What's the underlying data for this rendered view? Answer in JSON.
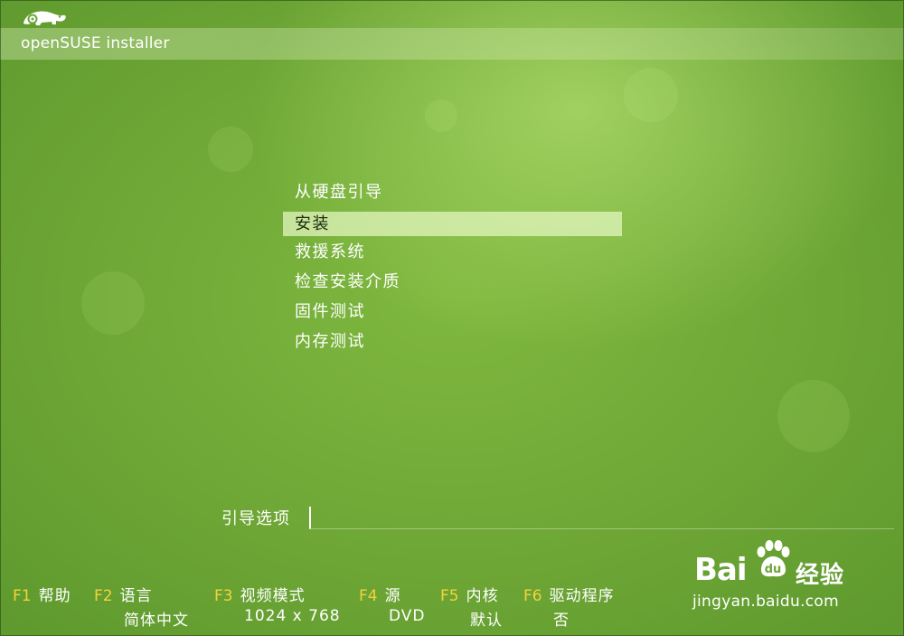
{
  "header": {
    "title": "openSUSE installer",
    "logo_icon": "chameleon-logo-icon"
  },
  "menu": {
    "items": [
      {
        "label": "从硬盘引导",
        "selected": false
      },
      {
        "label": "安装",
        "selected": true
      },
      {
        "label": "救援系统",
        "selected": false
      },
      {
        "label": "检查安装介质",
        "selected": false
      },
      {
        "label": "固件测试",
        "selected": false
      },
      {
        "label": "内存测试",
        "selected": false
      }
    ]
  },
  "boot_options": {
    "label": "引导选项",
    "value": ""
  },
  "function_keys": [
    {
      "key": "F1",
      "label": "帮助",
      "value": ""
    },
    {
      "key": "F2",
      "label": "语言",
      "value": "简体中文"
    },
    {
      "key": "F3",
      "label": "视频模式",
      "value": "1024 x 768"
    },
    {
      "key": "F4",
      "label": "源",
      "value": "DVD"
    },
    {
      "key": "F5",
      "label": "内核",
      "value": "默认"
    },
    {
      "key": "F6",
      "label": "驱动程序",
      "value": "否"
    }
  ],
  "watermark": {
    "brand_text": "Bai",
    "brand_suffix": "经验",
    "url": "jingyan.baidu.com",
    "paw_icon": "paw-icon"
  },
  "colors": {
    "background": "#6ba636",
    "fkey_accent": "#f4d23a",
    "selected_bg": "#e1f5be"
  }
}
